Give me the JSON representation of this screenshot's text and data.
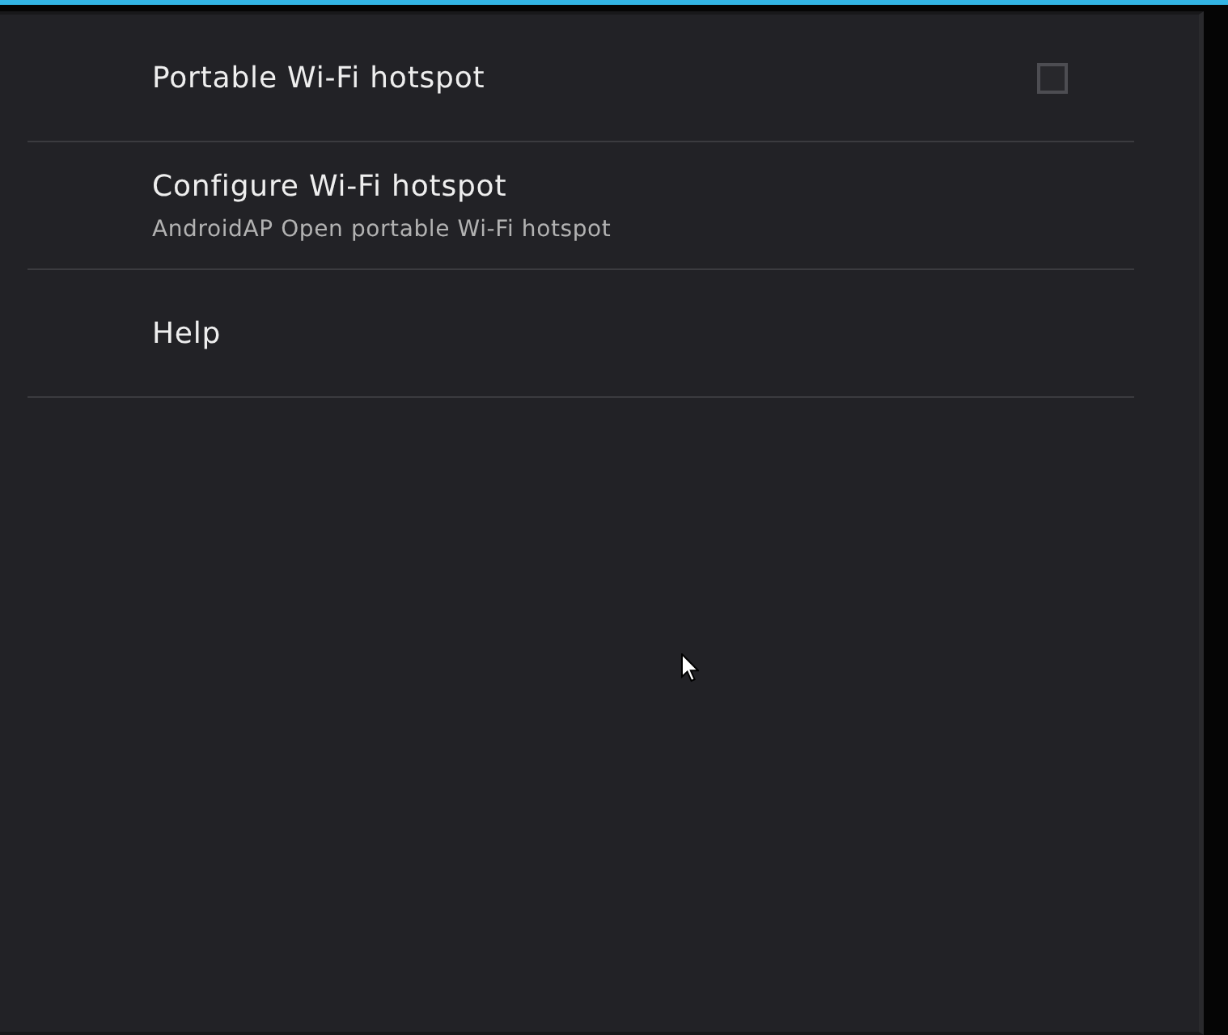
{
  "settings": {
    "items": [
      {
        "kind": "checkbox",
        "title": "Portable Wi-Fi hotspot",
        "checked": false
      },
      {
        "kind": "link",
        "title": "Configure Wi-Fi hotspot",
        "summary": "AndroidAP Open portable Wi-Fi hotspot"
      },
      {
        "kind": "link",
        "title": "Help"
      }
    ]
  }
}
